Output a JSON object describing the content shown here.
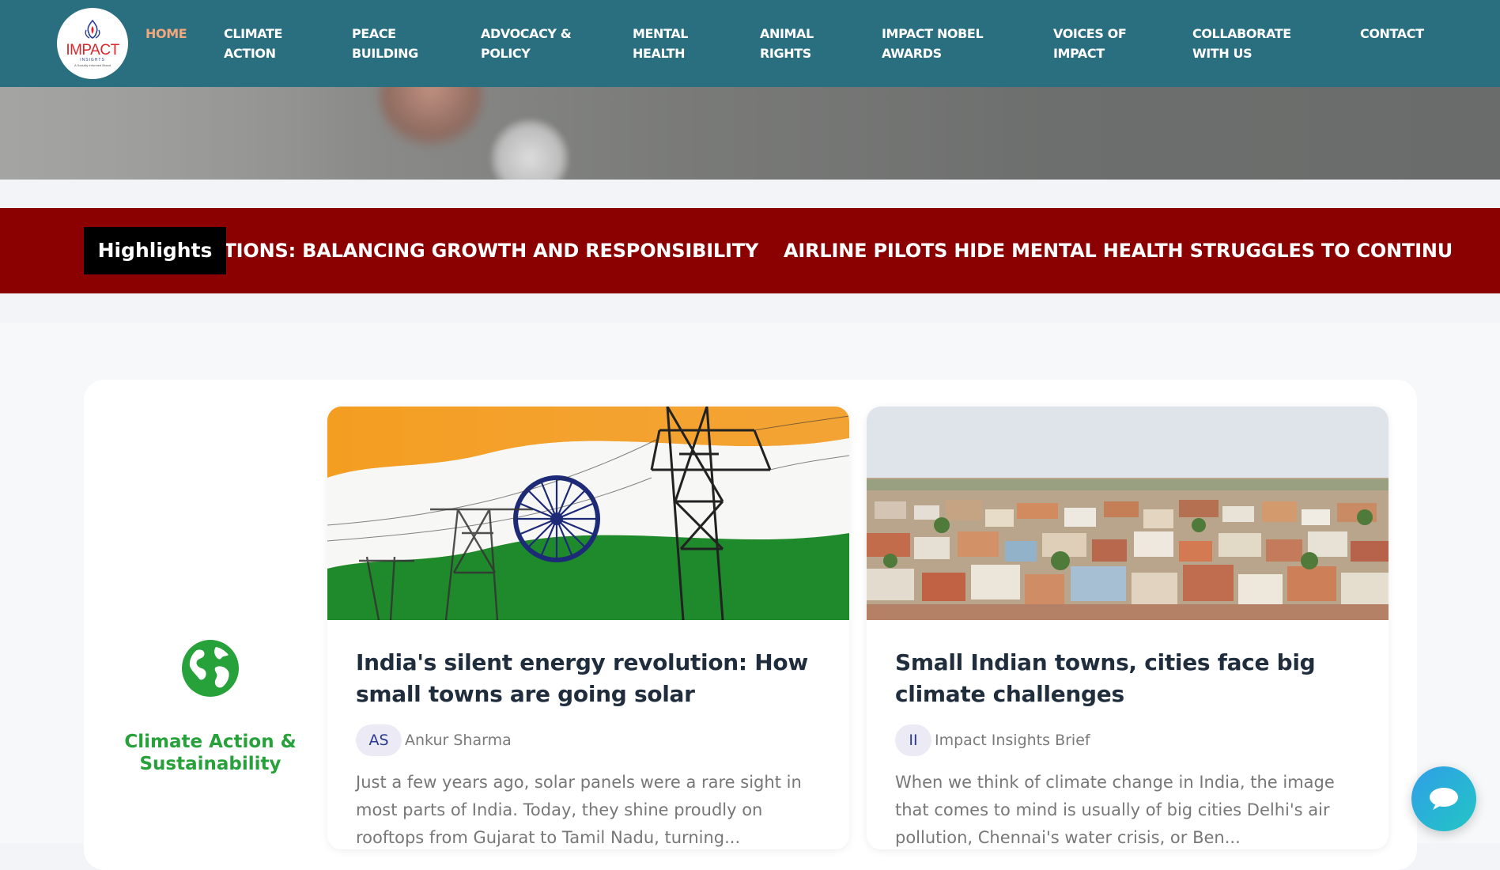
{
  "header": {
    "logo": {
      "word": "IMPACT",
      "sub": "INSIGHTS",
      "tagline": "A Socially Informed Brand"
    },
    "nav": [
      {
        "label": "HOME",
        "active": true
      },
      {
        "label": "CLIMATE\nACTION"
      },
      {
        "label": "PEACE\nBUILDING"
      },
      {
        "label": "ADVOCACY &\nPOLICY"
      },
      {
        "label": "MENTAL\nHEALTH"
      },
      {
        "label": "ANIMAL\nRIGHTS"
      },
      {
        "label": "IMPACT NOBEL\nAWARDS"
      },
      {
        "label": "VOICES OF\nIMPACT"
      },
      {
        "label": "COLLABORATE\nWITH US"
      },
      {
        "label": "CONTACT"
      }
    ]
  },
  "ticker": {
    "label": "Highlights",
    "items": [
      "ATIONS: BALANCING GROWTH AND RESPONSIBILITY",
      "AIRLINE PILOTS HIDE MENTAL HEALTH STRUGGLES TO CONTINU"
    ]
  },
  "category": {
    "label": "Climate Action &\nSustainability",
    "icon": "globe-icon",
    "color": "#27a13a"
  },
  "cards": [
    {
      "title": "India's silent energy revolution: How small towns are going solar",
      "author_initials": "AS",
      "author": "Ankur Sharma",
      "excerpt": "Just a few years ago, solar panels were a rare sight in most parts of India. Today, they shine proudly on rooftops from Gujarat to Tamil Nadu, turning..."
    },
    {
      "title": "Small Indian towns, cities face big climate challenges",
      "author_initials": "II",
      "author": "Impact Insights Brief",
      "excerpt": "When we think of climate change in India, the image that comes to mind is usually of big cities Delhi's air pollution, Chennai's water crisis, or Ben..."
    }
  ],
  "colors": {
    "header_bg": "#2a6f80",
    "nav_active": "#f3a77d",
    "ticker_bg": "#8b0000",
    "title_text": "#1f2d3d"
  }
}
